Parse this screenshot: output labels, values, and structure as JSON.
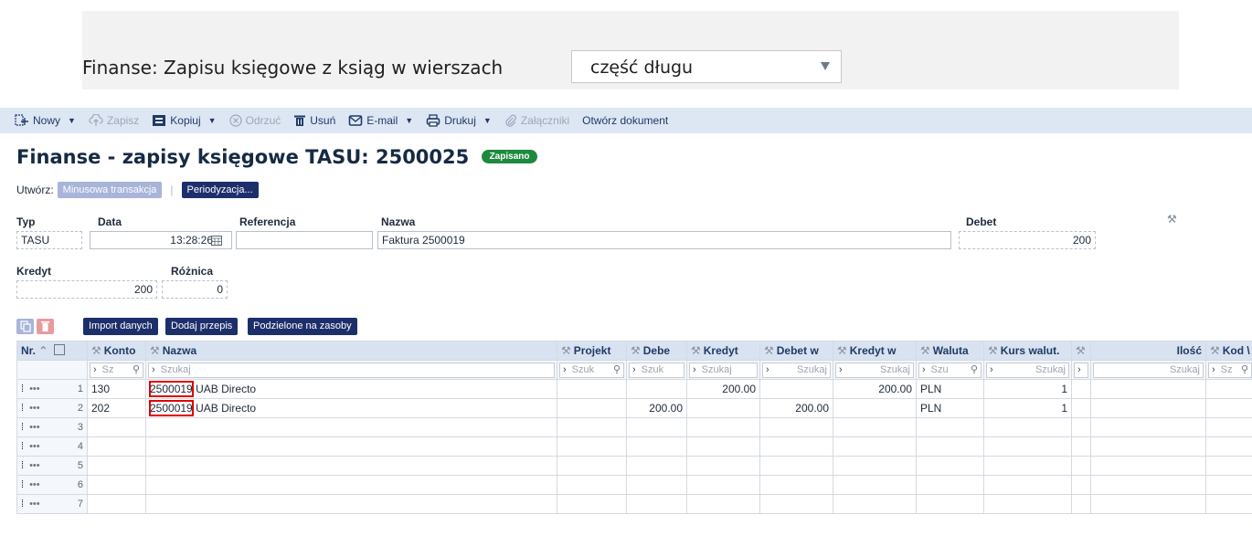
{
  "header": {
    "title": "Finanse: Zapisu księgowe z ksiąg w wierszach",
    "select_value": "część długu"
  },
  "toolbar": {
    "items": [
      {
        "label": "Nowy",
        "icon": "new-doc-icon",
        "dropdown": true,
        "disabled": false
      },
      {
        "label": "Zapisz",
        "icon": "cloud-upload-icon",
        "dropdown": false,
        "disabled": true
      },
      {
        "label": "Kopiuj",
        "icon": "copy-icon",
        "dropdown": true,
        "disabled": false
      },
      {
        "label": "Odrzuć",
        "icon": "discard-icon",
        "dropdown": false,
        "disabled": true
      },
      {
        "label": "Usuń",
        "icon": "trash-icon",
        "dropdown": false,
        "disabled": false
      },
      {
        "label": "E-mail",
        "icon": "email-icon",
        "dropdown": true,
        "disabled": false
      },
      {
        "label": "Drukuj",
        "icon": "print-icon",
        "dropdown": true,
        "disabled": false
      },
      {
        "label": "Załączniki",
        "icon": "paperclip-icon",
        "dropdown": false,
        "disabled": true
      },
      {
        "label": "Otwórz dokument",
        "icon": "",
        "dropdown": false,
        "disabled": false
      }
    ]
  },
  "page": {
    "title": "Finanse - zapisy księgowe TASU: 2500025",
    "status": "Zapisano"
  },
  "create": {
    "label": "Utwórz:",
    "minus_button": "Minusowa transakcja",
    "period_button": "Periodyzacja..."
  },
  "form": {
    "typ_label": "Typ",
    "typ_value": "TASU",
    "data_label": "Data",
    "data_value": "13:28:26",
    "ref_label": "Referencja",
    "ref_value": "",
    "nazwa_label": "Nazwa",
    "nazwa_value": "Faktura 2500019",
    "debet_label": "Debet",
    "debet_value": "200",
    "kredyt_label": "Kredyt",
    "kredyt_value": "200",
    "roznica_label": "Różnica",
    "roznica_value": "0"
  },
  "actions": {
    "import": "Import danych",
    "add_rule": "Dodaj przepis",
    "split": "Podzielone na zasoby"
  },
  "grid": {
    "columns": [
      "Nr.",
      "Konto",
      "Nazwa",
      "Projekt",
      "Debe",
      "Kredyt",
      "Debet w",
      "Kredyt w",
      "Waluta",
      "Kurs walut.",
      "",
      "Ilość",
      "Kod \\"
    ],
    "search": {
      "konto": "Sz",
      "nazwa": "Szukaj",
      "projekt": "Szuk",
      "debe": "Szuk",
      "kredyt": "Szukaj",
      "debet_w": "Szukaj",
      "kredyt_w": "Szukaj",
      "waluta": "Szu",
      "kurs": "Szukaj",
      "ilosc": "Szukaj",
      "kod": "Sz"
    },
    "rows": [
      {
        "nr": "1",
        "konto": "130",
        "ref": "2500019",
        "name": "UAB Directo",
        "projekt": "",
        "debe": "",
        "kredyt": "200.00",
        "debet_w": "",
        "kredyt_w": "200.00",
        "waluta": "PLN",
        "kurs": "1",
        "blank": "",
        "ilosc": "",
        "kod": ""
      },
      {
        "nr": "2",
        "konto": "202",
        "ref": "2500019",
        "name": "UAB Directo",
        "projekt": "",
        "debe": "200.00",
        "kredyt": "",
        "debet_w": "200.00",
        "kredyt_w": "",
        "waluta": "PLN",
        "kurs": "1",
        "blank": "",
        "ilosc": "",
        "kod": ""
      },
      {
        "nr": "3"
      },
      {
        "nr": "4"
      },
      {
        "nr": "5"
      },
      {
        "nr": "6"
      },
      {
        "nr": "7"
      }
    ]
  },
  "colors": {
    "toolbar_bg": "#dde6f3",
    "navy_button": "#1d2f6b",
    "status_green": "#1e8a3e",
    "highlight_red": "#e00000"
  }
}
